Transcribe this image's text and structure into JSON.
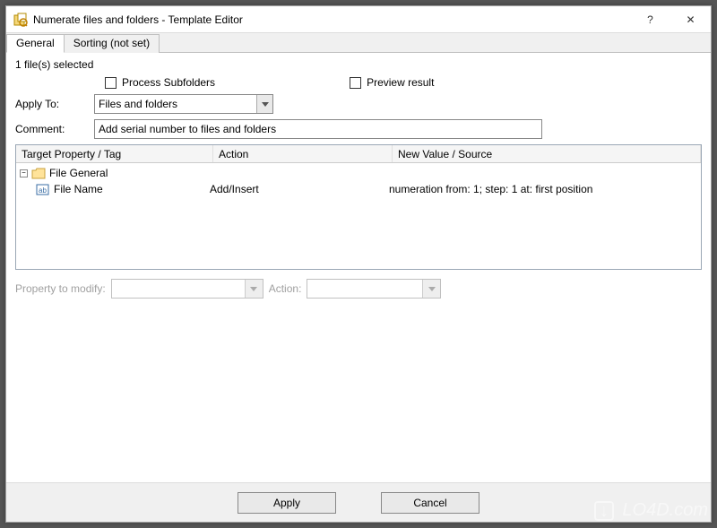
{
  "window": {
    "title": "Numerate files and folders - Template Editor",
    "help_symbol": "?",
    "close_symbol": "✕"
  },
  "tabs": {
    "general": "General",
    "sorting": "Sorting (not set)"
  },
  "status": {
    "files_selected": "1 file(s) selected"
  },
  "options": {
    "process_subfolders_label": "Process Subfolders",
    "preview_result_label": "Preview result",
    "apply_to_label": "Apply To:",
    "apply_to_value": "Files and folders",
    "comment_label": "Comment:",
    "comment_value": "Add serial number to files and folders"
  },
  "grid": {
    "headers": {
      "col1": "Target Property / Tag",
      "col2": "Action",
      "col3": "New Value / Source"
    },
    "rows": {
      "group_label": "File General",
      "item_label": "File Name",
      "item_action": "Add/Insert",
      "item_value": "numeration from: 1; step: 1 at: first position"
    }
  },
  "lower": {
    "property_label": "Property to modify:",
    "action_label": "Action:"
  },
  "footer": {
    "apply": "Apply",
    "cancel": "Cancel"
  },
  "watermark": {
    "text": "LO4D.com"
  }
}
